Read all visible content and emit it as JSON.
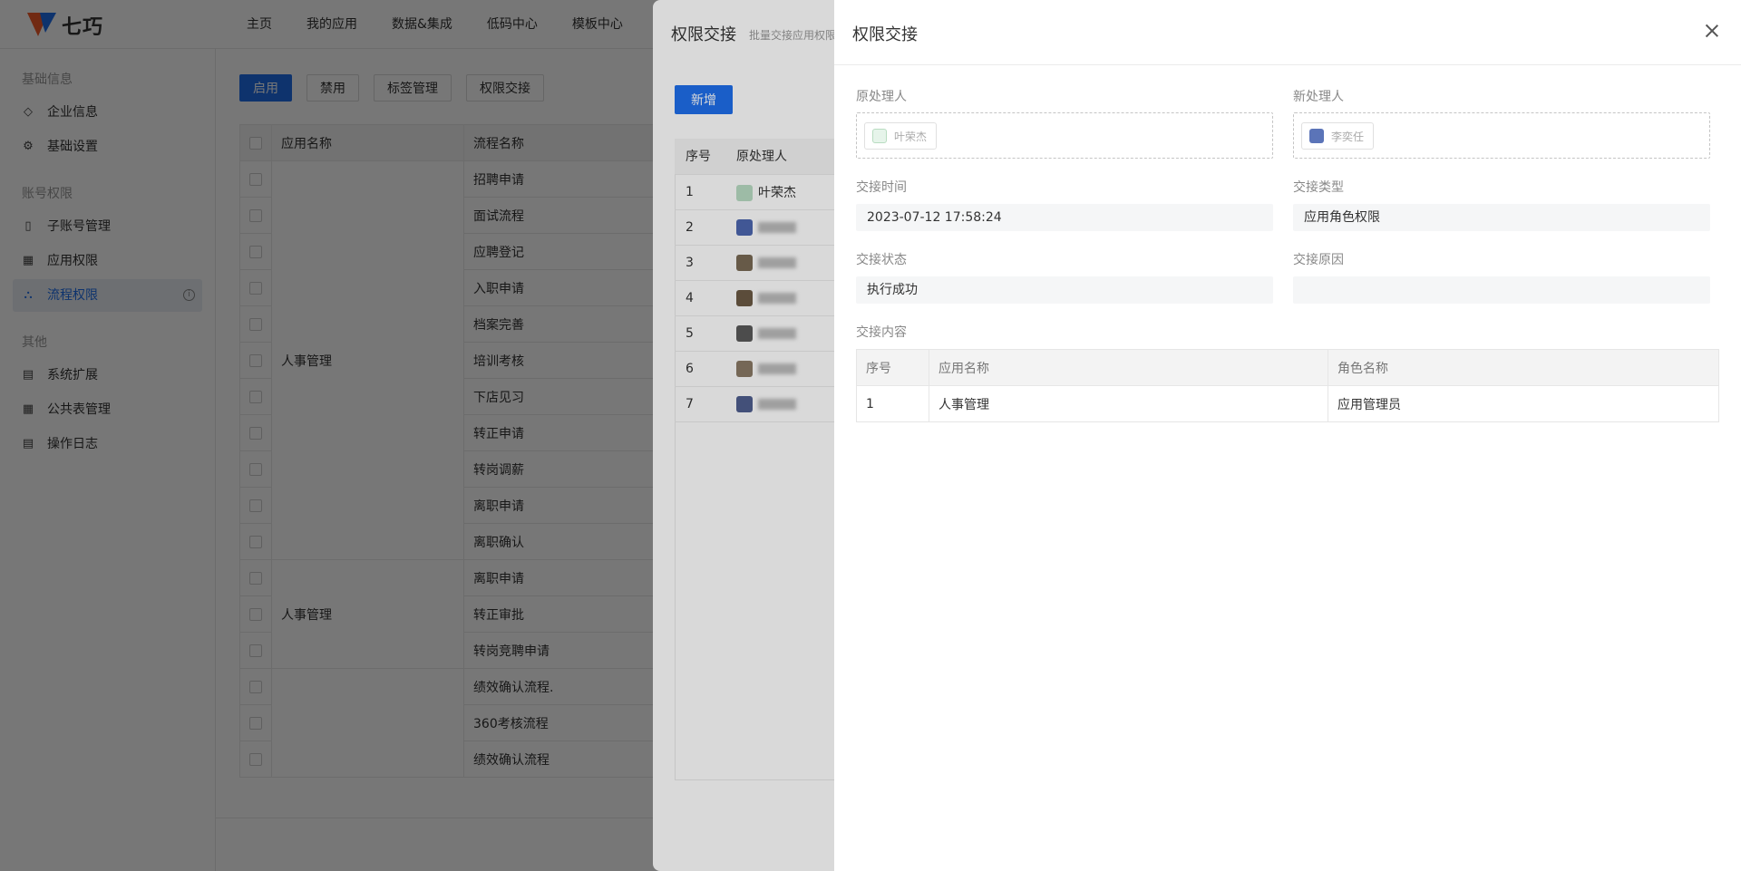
{
  "app": {
    "brand": "七巧",
    "nav": [
      "主页",
      "我的应用",
      "数据&集成",
      "低码中心",
      "模板中心"
    ]
  },
  "sidebar": {
    "groups": [
      {
        "title": "基础信息",
        "items": [
          {
            "label": "企业信息",
            "icon": "diamond-icon"
          },
          {
            "label": "基础设置",
            "icon": "gear-icon"
          }
        ]
      },
      {
        "title": "账号权限",
        "items": [
          {
            "label": "子账号管理",
            "icon": "id-card-icon"
          },
          {
            "label": "应用权限",
            "icon": "grid-icon"
          },
          {
            "label": "流程权限",
            "icon": "org-chart-icon",
            "active": true
          }
        ]
      },
      {
        "title": "其他",
        "items": [
          {
            "label": "系统扩展",
            "icon": "document-icon"
          },
          {
            "label": "公共表管理",
            "icon": "table-icon"
          },
          {
            "label": "操作日志",
            "icon": "log-icon"
          }
        ]
      }
    ]
  },
  "main": {
    "toolbar": {
      "enable": "启用",
      "disable": "禁用",
      "tag_manage": "标签管理",
      "permission_transfer": "权限交接"
    },
    "table": {
      "headers": [
        "应用名称",
        "流程名称"
      ],
      "groups": [
        {
          "app": "人事管理",
          "flows": [
            "招聘申请",
            "面试流程",
            "应聘登记",
            "入职申请",
            "档案完善",
            "培训考核",
            "下店见习",
            "转正申请",
            "转岗调薪",
            "离职申请",
            "离职确认"
          ]
        },
        {
          "app": "人事管理",
          "flows": [
            "离职申请",
            "转正审批",
            "转岗竞聘申请"
          ]
        },
        {
          "app": "",
          "flows": [
            "绩效确认流程.",
            "360考核流程",
            "绩效确认流程"
          ]
        }
      ]
    }
  },
  "drawer1": {
    "title": "权限交接",
    "subtitle": "批量交接应用权限",
    "add_button": "新增",
    "headers": [
      "序号",
      "原处理人"
    ],
    "rows": [
      {
        "no": "1",
        "name": "叶荣杰"
      },
      {
        "no": "2",
        "name": ""
      },
      {
        "no": "3",
        "name": ""
      },
      {
        "no": "4",
        "name": ""
      },
      {
        "no": "5",
        "name": ""
      },
      {
        "no": "6",
        "name": ""
      },
      {
        "no": "7",
        "name": ""
      }
    ]
  },
  "drawer2": {
    "title": "权限交接",
    "original_handler_label": "原处理人",
    "original_handler": "叶荣杰",
    "new_handler_label": "新处理人",
    "new_handler": "李奕任",
    "time_label": "交接时间",
    "time": "2023-07-12 17:58:24",
    "type_label": "交接类型",
    "type": "应用角色权限",
    "status_label": "交接状态",
    "status": "执行成功",
    "reason_label": "交接原因",
    "reason": "",
    "content_label": "交接内容",
    "content_headers": [
      "序号",
      "应用名称",
      "角色名称"
    ],
    "content_rows": [
      {
        "no": "1",
        "app": "人事管理",
        "role": "应用管理员"
      }
    ]
  },
  "colors": {
    "primary": "#1f6feb",
    "mask": "rgba(0,0,0,0.45)"
  }
}
